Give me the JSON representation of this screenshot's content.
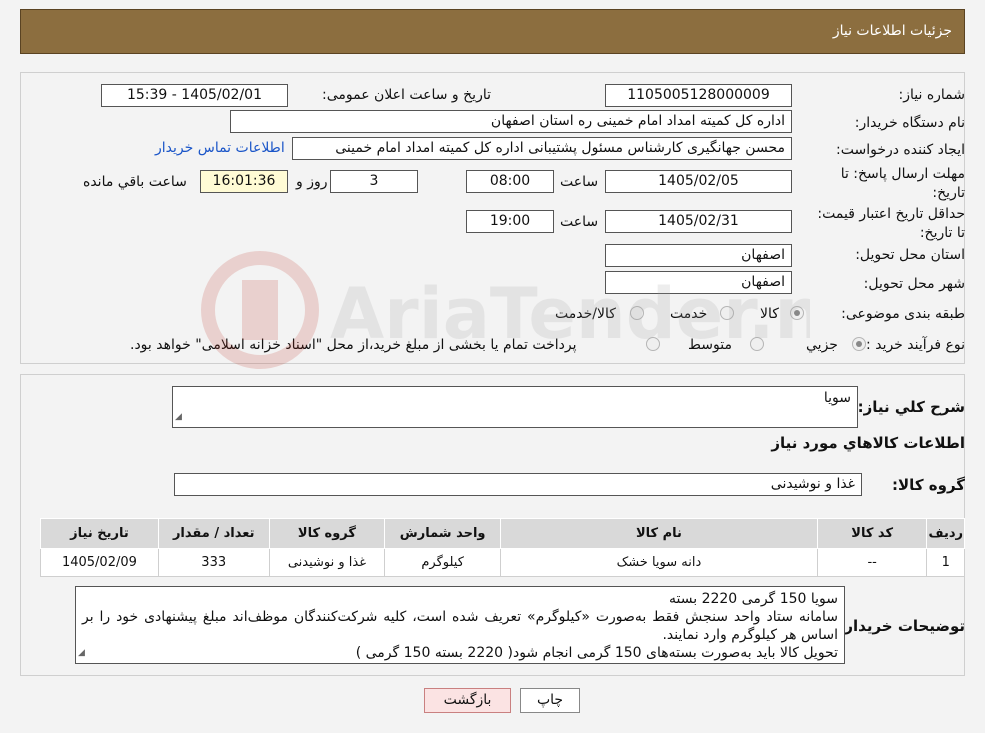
{
  "header": {
    "title": "جزئیات اطلاعات نیاز"
  },
  "details": {
    "need_number_label": "شماره نیاز:",
    "need_number": "1105005128000009",
    "announce_label": "تاریخ و ساعت اعلان عمومی:",
    "announce_value": "1405/02/01 - 15:39",
    "buyer_org_label": "نام دستگاه خریدار:",
    "buyer_org": "اداره کل کمیته امداد امام خمینی  ره  استان اصفهان",
    "creator_label": "ایجاد کننده درخواست:",
    "creator": "محسن جهانگیری کارشناس مسئول پشتیبانی اداره کل کمیته امداد امام خمینی",
    "contact_link": "اطلاعات تماس خریدار",
    "deadline_label": "مهلت ارسال پاسخ: تا تاریخ:",
    "deadline_date": "1405/02/05",
    "time_label": "ساعت",
    "deadline_time": "08:00",
    "days_value": "3",
    "days_label": "روز و",
    "remaining_time": "16:01:36",
    "remaining_label": "ساعت باقي مانده",
    "validity_label": "حداقل تاریخ اعتبار قیمت: تا تاریخ:",
    "validity_date": "1405/02/31",
    "validity_time": "19:00",
    "province_label": "استان محل تحویل:",
    "province": "اصفهان",
    "city_label": "شهر محل تحویل:",
    "city": "اصفهان",
    "category_label": "طبقه بندی موضوعی:",
    "category_options": [
      "کالا",
      "خدمت",
      "کالا/خدمت"
    ],
    "process_label": "نوع فرآیند خرید :",
    "process_options": [
      "جزیي",
      "متوسط"
    ],
    "process_note": "پرداخت تمام یا بخشی از مبلغ خرید،از محل \"اسناد خزانه اسلامی\" خواهد بود."
  },
  "needs": {
    "summary_label": "شرح کلي نياز:",
    "summary": "سویا",
    "items_title": "اطلاعات کالاهاي مورد نياز",
    "group_label": "گروه کالا:",
    "group": "غذا و نوشیدنی",
    "columns": [
      "رديف",
      "کد کالا",
      "نام کالا",
      "واحد شمارش",
      "گروه کالا",
      "تعداد / مقدار",
      "تاریخ نیاز"
    ],
    "rows": [
      [
        "1",
        "--",
        "دانه سویا خشک",
        "کیلوگرم",
        "غذا و نوشیدنی",
        "333",
        "1405/02/09"
      ]
    ],
    "notes_label": "توضیحات خریدار:",
    "notes": [
      "سویا 150 گرمی 2220 بسته",
      " سامانه ستاد واحد سنجش فقط به‌صورت «کیلوگرم» تعریف شده است، کلیه شرکت‌کنندگان موظف‌اند مبلغ پیشنهادی خود را بر اساس هر کیلوگرم وارد نمایند.",
      "تحویل کالا باید به‌صورت بسته‌های 150 گرمی  انجام شود( 2220 بسته  150 گرمی )"
    ]
  },
  "buttons": {
    "print": "چاپ",
    "back": "بازگشت"
  },
  "watermark": {
    "text": "AriaTender.neT"
  }
}
